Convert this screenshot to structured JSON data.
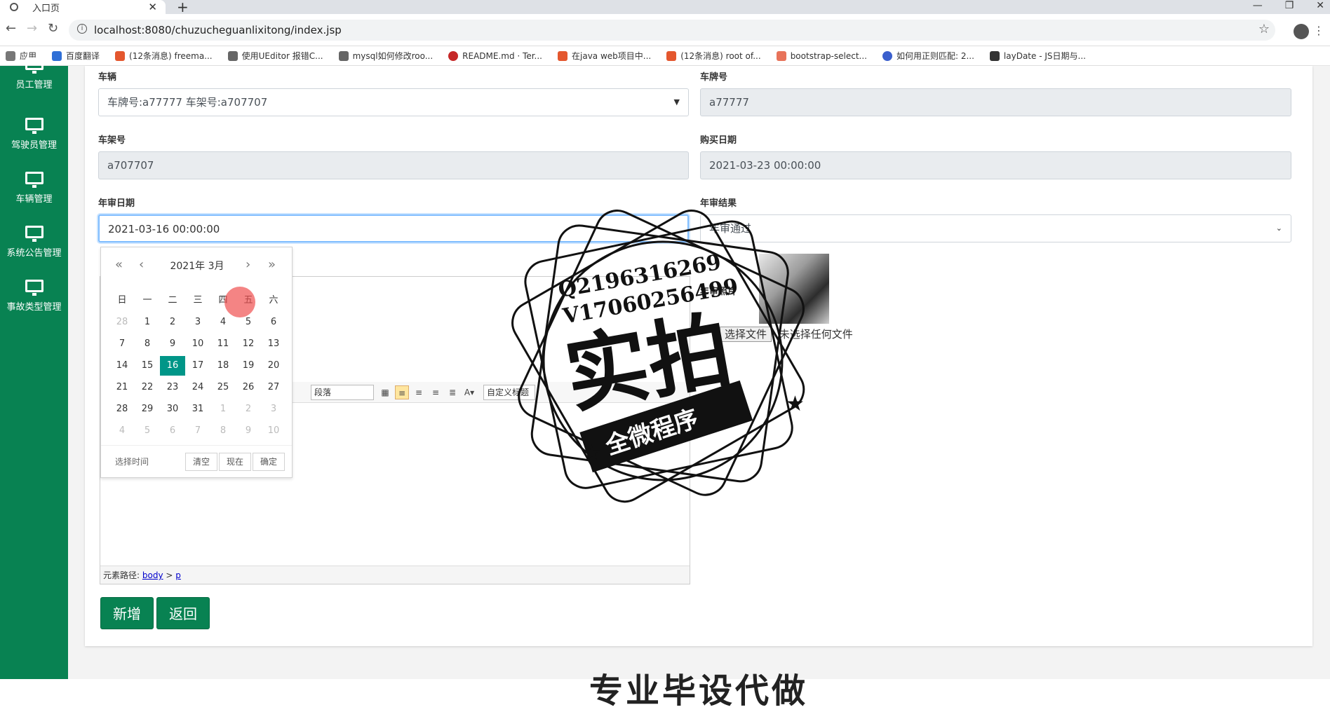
{
  "browser": {
    "tab_title": "入口页",
    "url": "localhost:8080/chuzucheguanlixitong/index.jsp",
    "bookmarks": [
      "应用",
      "百度翻译",
      "(12条消息) freema...",
      "使用UEditor 报错C...",
      "mysql如何修改roo...",
      "README.md · Ter...",
      "在java web项目中...",
      "(12条消息) root of...",
      "bootstrap-select...",
      "如何用正则匹配: 2...",
      "layDate - JS日期与..."
    ]
  },
  "sidebar": {
    "items": [
      {
        "label": "员工管理"
      },
      {
        "label": "驾驶员管理"
      },
      {
        "label": "车辆管理"
      },
      {
        "label": "系统公告管理"
      },
      {
        "label": "事故类型管理"
      }
    ]
  },
  "form": {
    "vehicle_label": "车辆",
    "vehicle_value": "车牌号:a77777 车架号:a707707",
    "plate_label": "车牌号",
    "plate_value": "a77777",
    "frame_label": "车架号",
    "frame_value": "a707707",
    "purchase_label": "购买日期",
    "purchase_value": "2021-03-23 00:00:00",
    "inspect_date_label": "年审日期",
    "inspect_date_value": "2021-03-16 00:00:00",
    "inspect_result_label": "年审结果",
    "inspect_result_value": "年审通过",
    "photo_label": "年审照片",
    "file_button": "选择文件",
    "file_status": "未选择任何文件"
  },
  "editor": {
    "paragraph_select": "段落",
    "custom_title_select": "自定义标题",
    "path_label": "元素路径:",
    "path_body": "body",
    "path_sep": ">",
    "path_p": "p"
  },
  "buttons": {
    "add": "新增",
    "back": "返回"
  },
  "datepicker": {
    "year": "2021年",
    "month": "3月",
    "weekdays": [
      "日",
      "一",
      "二",
      "三",
      "四",
      "五",
      "六"
    ],
    "rows": [
      [
        "28",
        "1",
        "2",
        "3",
        "4",
        "5",
        "6"
      ],
      [
        "7",
        "8",
        "9",
        "10",
        "11",
        "12",
        "13"
      ],
      [
        "14",
        "15",
        "16",
        "17",
        "18",
        "19",
        "20"
      ],
      [
        "21",
        "22",
        "23",
        "24",
        "25",
        "26",
        "27"
      ],
      [
        "28",
        "29",
        "30",
        "31",
        "1",
        "2",
        "3"
      ],
      [
        "4",
        "5",
        "6",
        "7",
        "8",
        "9",
        "10"
      ]
    ],
    "selected": "16",
    "select_time": "选择时间",
    "clear": "清空",
    "now": "现在",
    "confirm": "确定"
  },
  "watermark": {
    "line1": "Q2196316269",
    "line2": "V17060256499",
    "big": "实拍",
    "banner": "全微程序"
  },
  "footer_partial": "专业毕设代做"
}
